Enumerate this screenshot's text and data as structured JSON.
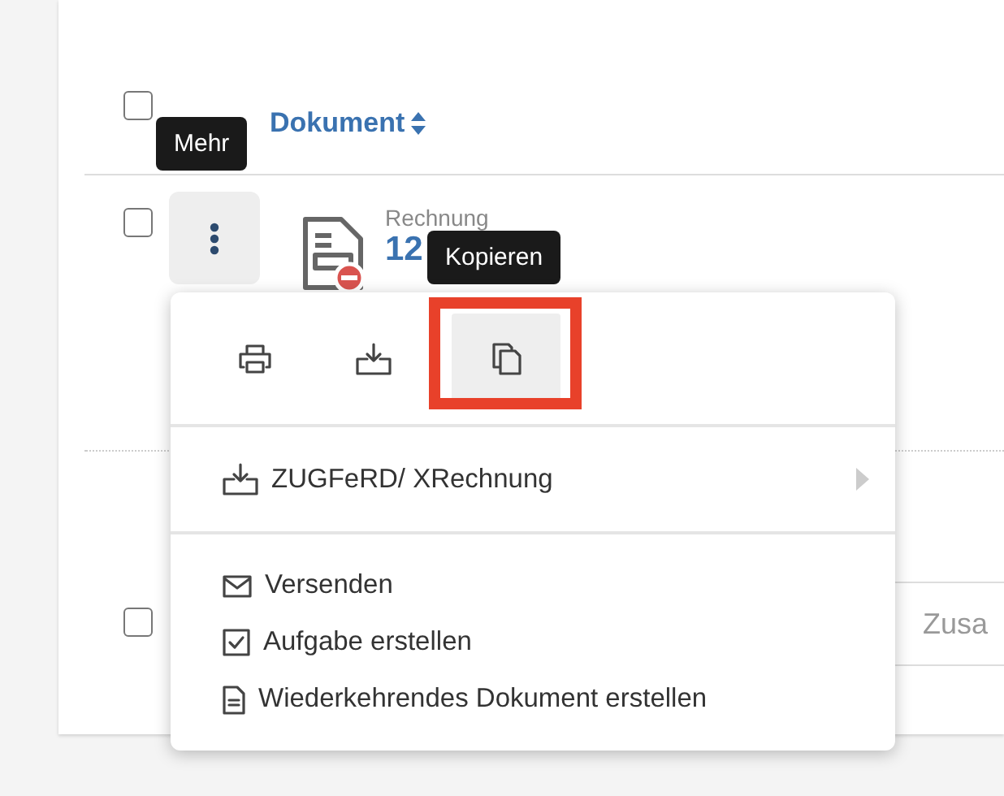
{
  "table": {
    "header": {
      "checked": false,
      "column": "Dokument"
    },
    "rows": [
      {
        "checked": false,
        "type": "Rechnung",
        "number": "12"
      },
      {
        "checked": false,
        "field_placeholder": "Zusa"
      }
    ]
  },
  "tooltips": [
    {
      "kind": "more",
      "label": "Mehr"
    },
    {
      "kind": "copy",
      "label": "Kopieren"
    }
  ],
  "menu": {
    "icon_actions": [
      {
        "kind": "print",
        "highlighted": false
      },
      {
        "kind": "download",
        "highlighted": false
      },
      {
        "kind": "copy",
        "highlighted": true
      }
    ],
    "submenu": {
      "label": "ZUGFeRD/ XRechnung"
    },
    "items": [
      {
        "kind": "mail",
        "label": "Versenden"
      },
      {
        "kind": "task",
        "label": "Aufgabe erstellen"
      },
      {
        "kind": "document",
        "label": "Wiederkehrendes Dokument erstellen"
      }
    ]
  }
}
